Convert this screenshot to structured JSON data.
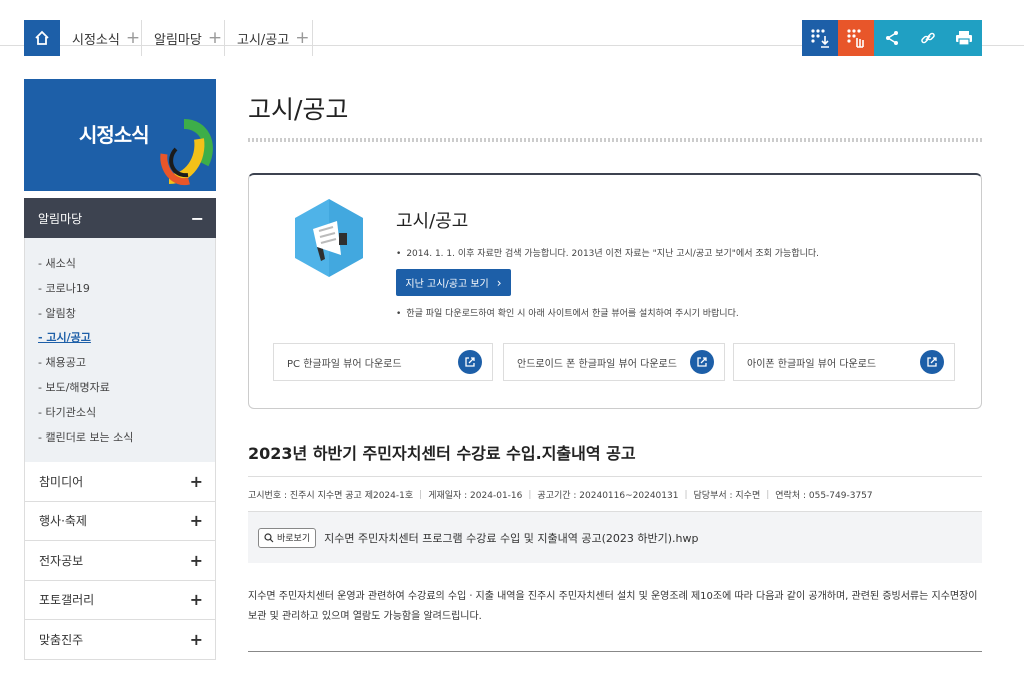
{
  "breadcrumb": [
    {
      "label": "시정소식"
    },
    {
      "label": "알림마당"
    },
    {
      "label": "고시/공고"
    }
  ],
  "toolbar": {
    "colors": [
      "#1d5fa8",
      "#e8562a",
      "#20a0c3",
      "#20a0c3",
      "#20a0c3"
    ]
  },
  "sidebar": {
    "banner_title": "시정소식",
    "section_title": "알림마당",
    "sub_items": [
      {
        "label": "- 새소식"
      },
      {
        "label": "- 코로나19"
      },
      {
        "label": "- 알림창"
      },
      {
        "label": "- 고시/공고"
      },
      {
        "label": "- 채용공고"
      },
      {
        "label": "- 보도/해명자료"
      },
      {
        "label": "- 타기관소식"
      },
      {
        "label": "- 캘린더로 보는 소식"
      }
    ],
    "main_items": [
      {
        "label": "참미디어"
      },
      {
        "label": "행사·축제"
      },
      {
        "label": "전자공보"
      },
      {
        "label": "포토갤러리"
      },
      {
        "label": "맞춤진주"
      }
    ]
  },
  "page": {
    "title": "고시/공고"
  },
  "info": {
    "title": "고시/공고",
    "note1": "2014. 1. 1. 이후 자료만 검색 가능합니다. 2013년 이전 자료는 \"지난 고시/공고 보기\"에서 조회 가능합니다.",
    "past_button": "지난 고시/공고 보기",
    "note2": "한글 파일 다운로드하여 확인 시 아래 사이트에서 한글 뷰어를 설치하여 주시기 바랍니다.",
    "downloads": [
      {
        "label": "PC 한글파일 뷰어 다운로드"
      },
      {
        "label": "안드로이드 폰 한글파일 뷰어 다운로드"
      },
      {
        "label": "아이폰 한글파일 뷰어 다운로드"
      }
    ]
  },
  "post": {
    "title": "2023년 하반기 주민자치센터 수강료 수입.지출내역 공고",
    "meta": [
      "고시번호 : 진주시 지수면 공고 제2024-1호",
      "게재일자 : 2024-01-16",
      "공고기간 : 20240116~20240131",
      "담당부서 : 지수면",
      "연락처 : 055-749-3757"
    ],
    "view_button": "바로보기",
    "file_name": "지수면 주민자치센터 프로그램 수강료 수입 및 지출내역 공고(2023 하반기).hwp",
    "body": "지수면 주민자치센터 운영과 관련하여 수강료의 수입ㆍ지출 내역을 진주시 주민자치센터 설치 및 운영조례 제10조에 따라 다음과 같이 공개하며, 관련된 증빙서류는 지수면장이 보관 및 관리하고 있으며 열람도 가능함을 알려드립니다."
  }
}
